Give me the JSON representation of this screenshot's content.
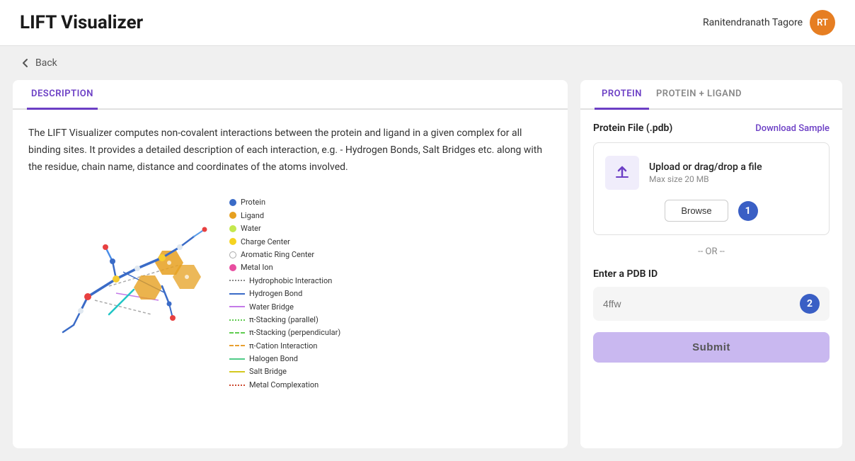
{
  "header": {
    "title": "LIFT Visualizer",
    "user_name": "Ranitendranath Tagore",
    "avatar_initials": "RT"
  },
  "back": {
    "label": "Back"
  },
  "left_panel": {
    "tab_description": "DESCRIPTION",
    "description_text": "The LIFT Visualizer computes non-covalent interactions between the protein and ligand in a given complex for all binding sites. It provides a detailed description of each interaction, e.g. - Hydrogen Bonds, Salt Bridges etc. along with the residue, chain name, distance and coordinates of the atoms involved.",
    "legend": [
      {
        "type": "dot",
        "color": "#3a6bc7",
        "label": "Protein"
      },
      {
        "type": "dot",
        "color": "#e6a020",
        "label": "Ligand"
      },
      {
        "type": "dot",
        "color": "#c4e84e",
        "label": "Water"
      },
      {
        "type": "dot",
        "color": "#f5d320",
        "label": "Charge Center"
      },
      {
        "type": "dot-outline",
        "color": "#aaa",
        "label": "Aromatic Ring Center"
      },
      {
        "type": "dot",
        "color": "#e84ea0",
        "label": "Metal Ion"
      },
      {
        "type": "dashed",
        "color": "#888",
        "label": "Hydrophobic Interaction"
      },
      {
        "type": "line",
        "color": "#3a6bc7",
        "label": "Hydrogen Bond"
      },
      {
        "type": "line",
        "color": "#c47ae8",
        "label": "Water Bridge"
      },
      {
        "type": "dotted",
        "color": "#5fcc50",
        "label": "π-Stacking (parallel)"
      },
      {
        "type": "dotted",
        "color": "#5fcc50",
        "label": "π-Stacking (perpendicular)"
      },
      {
        "type": "dashed2",
        "color": "#e8a030",
        "label": "π-Cation Interaction"
      },
      {
        "type": "line",
        "color": "#50cc88",
        "label": "Halogen Bond"
      },
      {
        "type": "line",
        "color": "#d4c820",
        "label": "Salt Bridge"
      },
      {
        "type": "dashed3",
        "color": "#cc4a30",
        "label": "Metal Complexation"
      }
    ]
  },
  "right_panel": {
    "tab_protein": "PROTEIN",
    "tab_protein_ligand": "PROTEIN + LIGAND",
    "file_label": "Protein File (.pdb)",
    "download_sample": "Download Sample",
    "upload_text": "Upload or drag/drop a file",
    "upload_sub": "Max size 20 MB",
    "browse_label": "Browse",
    "badge1": "1",
    "or_text": "-- OR --",
    "pdb_label": "Enter a PDB ID",
    "pdb_placeholder": "4ffw",
    "badge2": "2",
    "submit_label": "Submit"
  }
}
